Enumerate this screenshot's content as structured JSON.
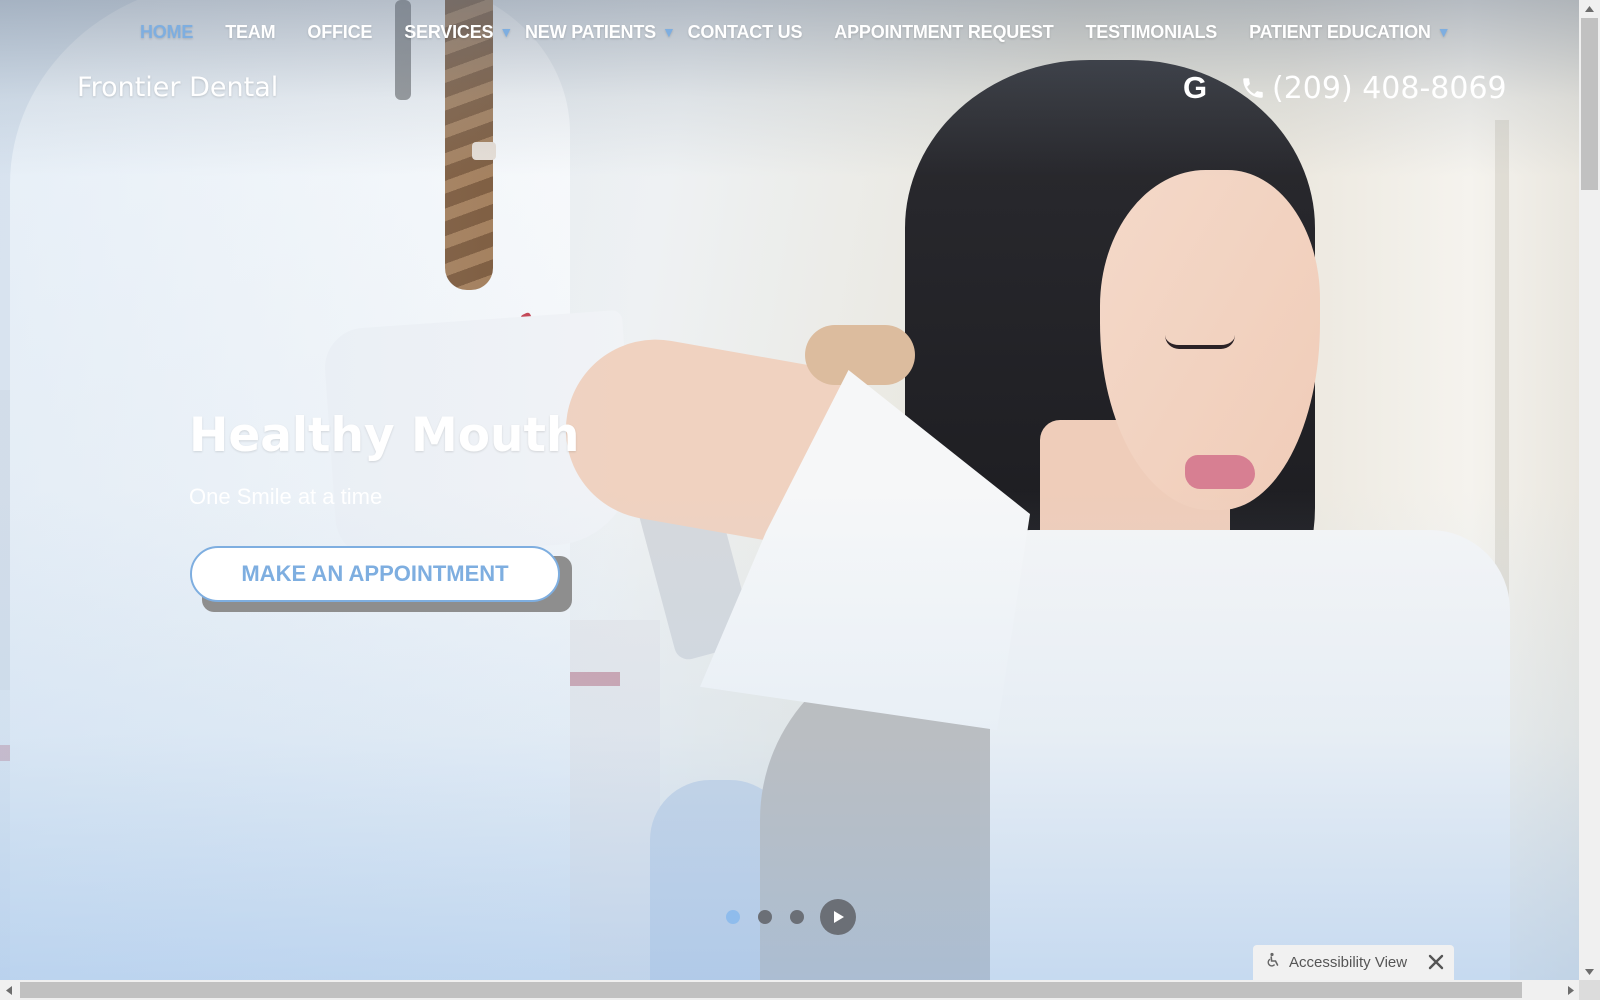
{
  "nav": {
    "items": [
      {
        "label": "HOME",
        "active": true,
        "has_dropdown": false
      },
      {
        "label": "TEAM",
        "active": false,
        "has_dropdown": false
      },
      {
        "label": "OFFICE",
        "active": false,
        "has_dropdown": false
      },
      {
        "label": "SERVICES",
        "active": false,
        "has_dropdown": true
      },
      {
        "label": "NEW PATIENTS",
        "active": false,
        "has_dropdown": true
      },
      {
        "label": "CONTACT US",
        "active": false,
        "has_dropdown": false
      },
      {
        "label": "APPOINTMENT REQUEST",
        "active": false,
        "has_dropdown": false
      },
      {
        "label": "TESTIMONIALS",
        "active": false,
        "has_dropdown": false
      },
      {
        "label": "PATIENT EDUCATION",
        "active": false,
        "has_dropdown": true
      }
    ],
    "caret_glyph": "▼"
  },
  "header": {
    "brand": "Frontier Dental",
    "google_letter": "G",
    "google_icon": "google-icon",
    "phone_icon": "phone-icon",
    "phone": "(209) 408-8069"
  },
  "hero": {
    "title": "Healthy Mouth",
    "subtitle": "One Smile at a time",
    "cta_label": "MAKE AN APPOINTMENT"
  },
  "carousel": {
    "slide_count": 3,
    "active_index": 0,
    "play_icon": "play-icon"
  },
  "accessibility": {
    "label": "Accessibility View",
    "icon": "wheelchair-icon",
    "close_icon": "close-icon"
  },
  "colors": {
    "accent": "#7eaee0",
    "text_light": "#ffffff",
    "control_dark": "#6b6f76",
    "dot_active": "#8fbcec"
  }
}
